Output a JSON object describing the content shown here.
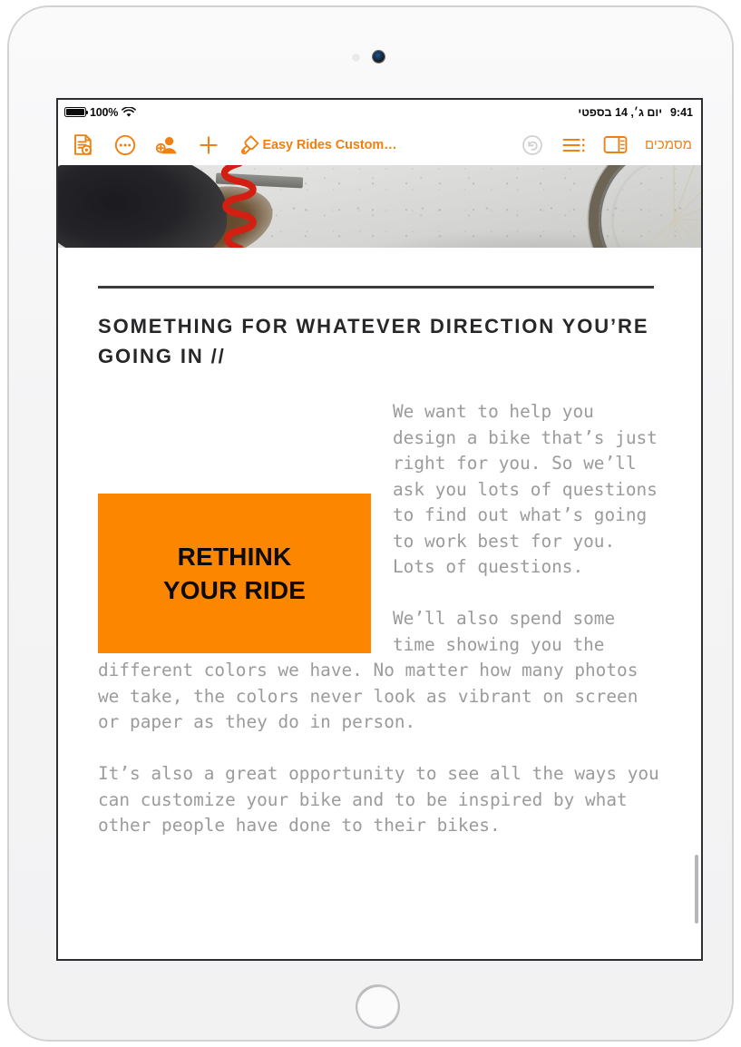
{
  "status_bar": {
    "battery_percent": "100%",
    "battery_level": 100,
    "wifi_icon": "wifi-icon",
    "date": "יום ג׳, 14 בספטי",
    "time": "9:41"
  },
  "toolbar": {
    "left_items": [
      {
        "name": "document-preview-icon",
        "label": "תצוגת מסמך"
      },
      {
        "name": "more-options-icon",
        "label": "עוד"
      },
      {
        "name": "add-collaborator-icon",
        "label": "שיתוף פעולה"
      },
      {
        "name": "insert-icon",
        "label": "הוספה"
      },
      {
        "name": "format-brush-icon",
        "label": "עיצוב"
      }
    ],
    "title": "Easy Rides Custom…",
    "right_items": [
      {
        "name": "undo-icon",
        "label": "ביטול",
        "disabled": true
      },
      {
        "name": "outline-list-icon",
        "label": "תצוגת מתאר"
      },
      {
        "name": "view-options-icon",
        "label": "אפשרויות תצוגה"
      }
    ],
    "documents_label": "מסמכים",
    "accent_color": "#f08010"
  },
  "document": {
    "banner": {
      "name": "bike-photo-banner",
      "alt": "תצלום של אופניים על רקע בטון בהיר"
    },
    "divider": true,
    "heading": "SOMETHING FOR WHATEVER DIRECTION YOU’RE GOING IN //",
    "paragraphs": [
      "We want to help you design a bike that’s just right for you. So we’ll ask you lots of questions to find out what’s going to work best for you. Lots of questions.",
      "We’ll also spend some time showing you the different colors we have. No matter how many photos we take, the colors never look as vibrant on screen or paper as they do in person.",
      "It’s also a great opportunity to see all the ways you can customize your bike and to be inspired by what other people have done to their bikes."
    ],
    "callout": {
      "line1": "RETHINK",
      "line2": "YOUR RIDE",
      "background_color": "#fc8600",
      "text_color": "#0b0b0c"
    },
    "body_text_color": "#9b9b9b",
    "heading_color": "#272729"
  }
}
